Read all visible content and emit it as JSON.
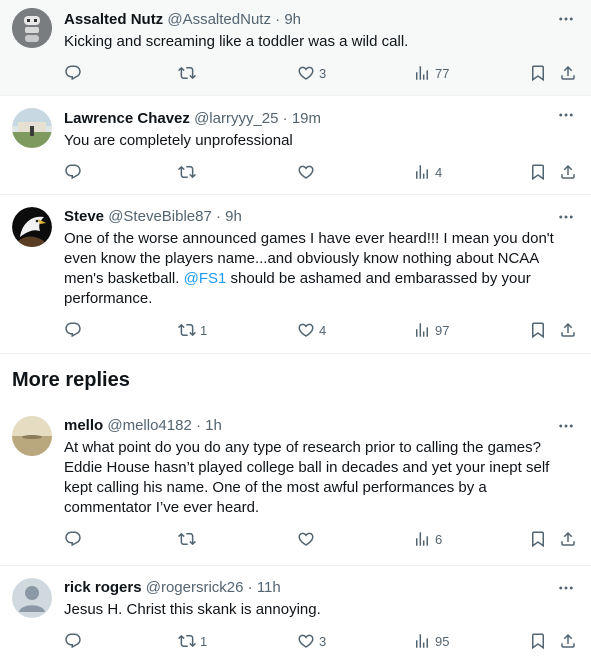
{
  "replies": [
    {
      "name": "Assalted Nutz",
      "handle": "@AssaltedNutz",
      "time": "9h",
      "text": "Kicking and screaming like a toddler was a wild call.",
      "replies": "",
      "reposts": "",
      "likes": "3",
      "views": "77"
    },
    {
      "name": "Lawrence Chavez",
      "handle": "@larryyy_25",
      "time": "19m",
      "text": "You are completely unprofessional",
      "replies": "",
      "reposts": "",
      "likes": "",
      "views": "4"
    },
    {
      "name": "Steve",
      "handle": "@SteveBible87",
      "time": "9h",
      "text_before": "One of the worse announced games I have ever heard!!! I mean you don't even know the players name...and obviously know nothing about NCAA men's basketball. ",
      "mention": "@FS1",
      "text_after": " should be ashamed and embarassed by your performance.",
      "replies": "",
      "reposts": "1",
      "likes": "4",
      "views": "97"
    }
  ],
  "section_title": "More replies",
  "more_replies": [
    {
      "name": "mello",
      "handle": "@mello4182",
      "time": "1h",
      "text": "At what point do you do any type of research prior to calling the games? Eddie House hasn’t played college ball in decades and yet your inept self kept calling his name. One of the most awful performances by a commentator I’ve ever heard.",
      "replies": "",
      "reposts": "",
      "likes": "",
      "views": "6"
    },
    {
      "name": "rick rogers",
      "handle": "@rogersrick26",
      "time": "11h",
      "text": "Jesus H. Christ this skank is annoying.",
      "replies": "",
      "reposts": "1",
      "likes": "3",
      "views": "95"
    }
  ],
  "sep": "·",
  "colors": {
    "accent": "#1d9bf0",
    "muted": "#536471",
    "text": "#0f1419"
  }
}
